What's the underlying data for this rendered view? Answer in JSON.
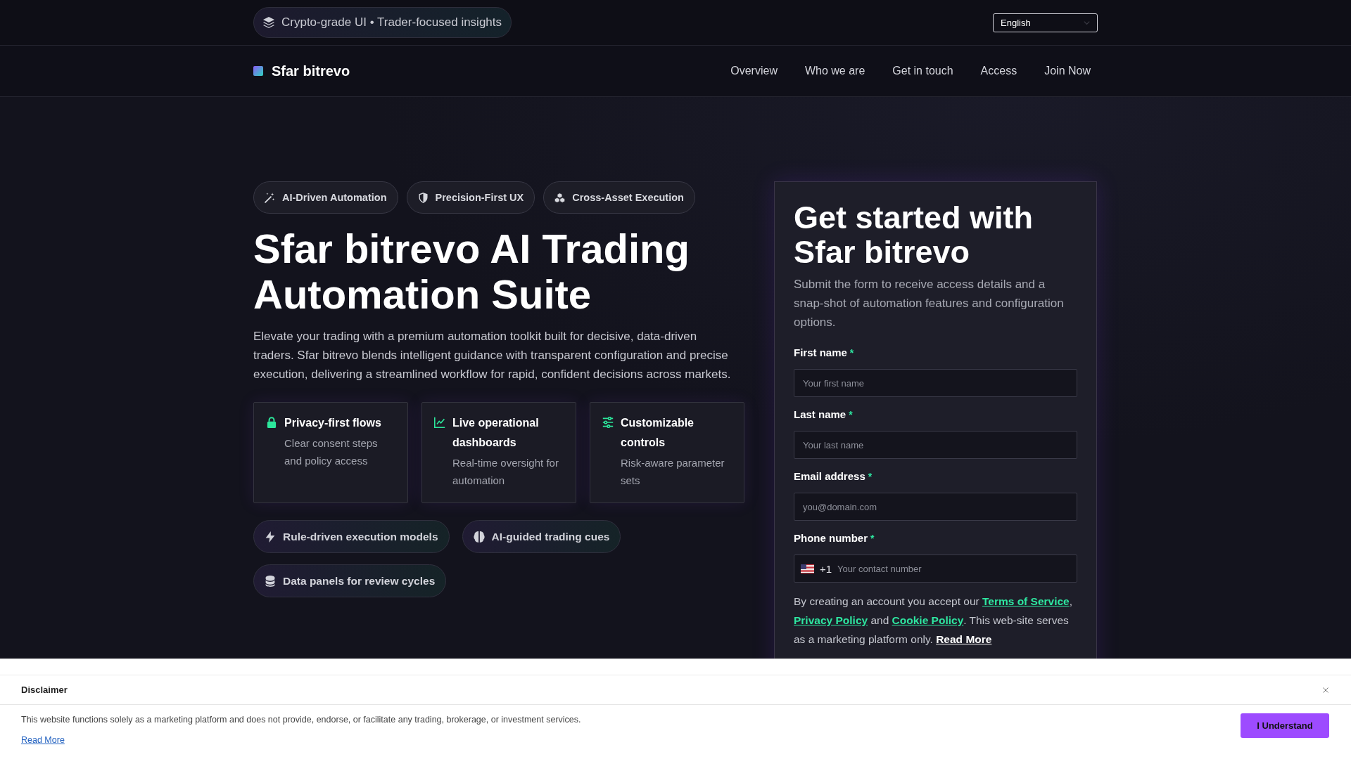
{
  "top_bar": {
    "tagline": "Crypto-grade UI • Trader-focused insights",
    "language": "English"
  },
  "nav": {
    "brand": "Sfar bitrevo",
    "links": [
      "Overview",
      "Who we are",
      "Get in touch",
      "Access",
      "Join Now"
    ]
  },
  "hero": {
    "badges": [
      "AI-Driven Automation",
      "Precision-First UX",
      "Cross-Asset Execution"
    ],
    "title": "Sfar bitrevo AI Trading Automation Suite",
    "description": "Elevate your trading with a premium automation toolkit built for decisive, data-driven traders. Sfar bitrevo blends intelligent guidance with transparent configuration and precise execution, delivering a streamlined workflow for rapid, confident decisions across markets.",
    "features": [
      {
        "title": "Privacy-first flows",
        "description": "Clear consent steps and policy access"
      },
      {
        "title": "Live operational dashboards",
        "description": "Real-time oversight for automation"
      },
      {
        "title": "Customizable controls",
        "description": "Risk-aware parameter sets"
      }
    ],
    "chips": [
      "Rule-driven execution models",
      "AI-guided trading cues",
      "Data panels for review cycles"
    ]
  },
  "form": {
    "title": "Get started with Sfar bitrevo",
    "subtitle": "Submit the form to receive access details and a snap-shot of automation features and configuration options.",
    "fields": [
      {
        "kind": "text",
        "label": "First name",
        "required_mark": "*",
        "placeholder": "Your first name"
      },
      {
        "kind": "text",
        "label": "Last name",
        "required_mark": "*",
        "placeholder": "Your last name"
      },
      {
        "kind": "email",
        "label": "Email address",
        "required_mark": "*",
        "placeholder": "you@domain.com"
      },
      {
        "kind": "phone",
        "label": "Phone number",
        "required_mark": "*",
        "dial_code": "+1",
        "placeholder": "Your contact number"
      }
    ],
    "consent": [
      {
        "kind": "text",
        "text": "By creating an account you accept our "
      },
      {
        "kind": "link",
        "text": "Terms of Service"
      },
      {
        "kind": "text",
        "text": ", "
      },
      {
        "kind": "link",
        "text": "Privacy Policy"
      },
      {
        "kind": "text",
        "text": " and "
      },
      {
        "kind": "link",
        "text": "Cookie Policy"
      },
      {
        "kind": "text",
        "text": ". This web-site serves as a marketing platform only. "
      },
      {
        "kind": "more_link",
        "text": "Read More"
      }
    ]
  },
  "disclaimer": {
    "title": "Disclaimer",
    "text": "This website functions solely as a marketing platform and does not provide, endorse, or facilitate any trading, brokerage, or investment services.",
    "link": "Read More",
    "button": "I Understand"
  }
}
